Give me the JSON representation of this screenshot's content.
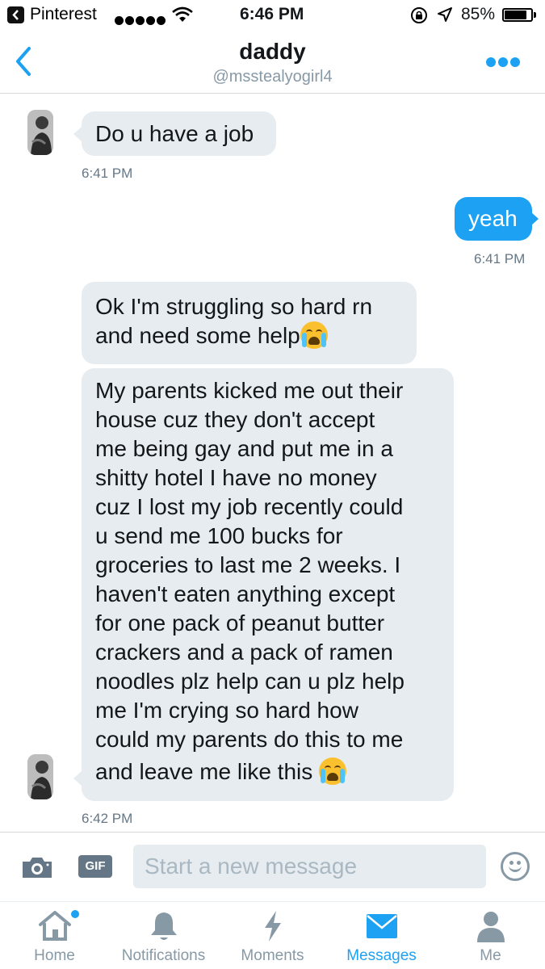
{
  "status_bar": {
    "app_name": "Pinterest",
    "time": "6:46 PM",
    "battery": "85%",
    "battery_level": 0.85
  },
  "header": {
    "title": "daddy",
    "handle": "@msstealyogirl4"
  },
  "messages": [
    {
      "direction": "in",
      "text": "Do u have a job",
      "time": "6:41 PM"
    },
    {
      "direction": "out",
      "text": "yeah",
      "time": "6:41 PM"
    },
    {
      "direction": "in",
      "lines": [
        "Ok I'm struggling so hard rn",
        "and need some help"
      ],
      "emoji": "loudly-crying-face"
    },
    {
      "direction": "in",
      "lines": [
        "My parents kicked me out their",
        "house cuz they don't accept",
        "me being gay and put me in a",
        "shitty hotel I have no money",
        "cuz I lost my job recently could",
        "u send me 100 bucks for",
        "groceries to last me 2 weeks. I",
        "haven't eaten anything except",
        "for one pack of peanut butter",
        "crackers and a pack of ramen",
        "noodles plz help can u plz help",
        "me I'm crying so hard how",
        "could my parents do this to me",
        "and leave me like this "
      ],
      "emoji": "loudly-crying-face",
      "time": "6:42 PM"
    }
  ],
  "composer": {
    "placeholder": "Start a new message",
    "gif_label": "GIF"
  },
  "tabs": [
    {
      "label": "Home",
      "icon": "home-icon",
      "badge": true
    },
    {
      "label": "Notifications",
      "icon": "bell-icon"
    },
    {
      "label": "Moments",
      "icon": "lightning-icon"
    },
    {
      "label": "Messages",
      "icon": "envelope-icon",
      "active": true
    },
    {
      "label": "Me",
      "icon": "person-icon"
    }
  ],
  "colors": {
    "accent": "#1da1f2",
    "bubble_in": "#e6ecf0",
    "muted": "#8899a6"
  }
}
